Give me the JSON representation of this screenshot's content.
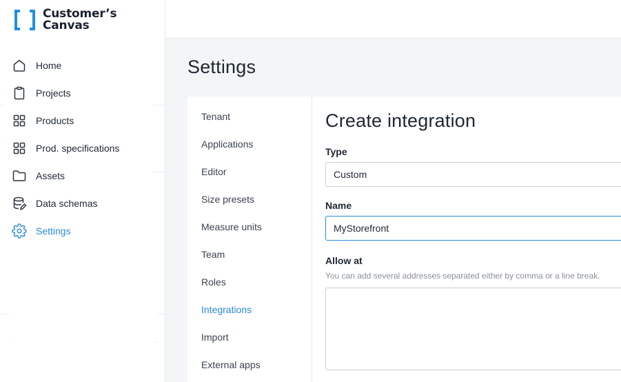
{
  "brand": {
    "line1": "Customer’s",
    "line2": "Canvas",
    "accent_color": "#1e8fe1"
  },
  "sidebar": {
    "items": [
      {
        "label": "Home",
        "icon": "home-icon"
      },
      {
        "label": "Projects",
        "icon": "clipboard-icon"
      },
      {
        "label": "Products",
        "icon": "grid-icon"
      },
      {
        "label": "Prod. specifications",
        "icon": "grid-icon"
      },
      {
        "label": "Assets",
        "icon": "folder-icon"
      },
      {
        "label": "Data schemas",
        "icon": "database-edit-icon"
      },
      {
        "label": "Settings",
        "icon": "gear-icon",
        "active": true
      }
    ],
    "active_color": "#2a8ad8"
  },
  "page": {
    "title": "Settings"
  },
  "settings_nav": {
    "items": [
      "Tenant",
      "Applications",
      "Editor",
      "Size presets",
      "Measure units",
      "Team",
      "Roles",
      "Integrations",
      "Import",
      "External apps"
    ],
    "active": "Integrations"
  },
  "form": {
    "title": "Create integration",
    "type": {
      "label": "Type",
      "value": "Custom"
    },
    "name": {
      "label": "Name",
      "value": "MyStorefront"
    },
    "allow_at": {
      "label": "Allow at",
      "hint": "You can add several addresses separated either by comma or a line break.",
      "value": ""
    }
  }
}
